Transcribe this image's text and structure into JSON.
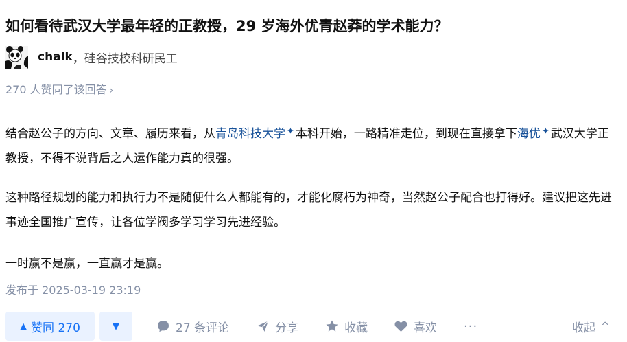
{
  "question": {
    "title": "如何看待武汉大学最年轻的正教授，29 岁海外优青赵莽的学术能力？"
  },
  "author": {
    "name": "chalk",
    "separator": "，",
    "bio": "硅谷技校科研民工"
  },
  "answer": {
    "votes_summary": "270 人赞同了该回答",
    "votes_chevron": "›",
    "p1_before": "结合赵公子的方向、文章、履历来看，从",
    "p1_link1": "青岛科技大学",
    "p1_mid": "本科开始，一路精准走位，到现在直接拿下",
    "p1_link2": "海优",
    "p1_after": "武汉大学正教授，不得不说背后之人运作能力真的很强。",
    "p2": "这种路径规划的能力和执行力不是随便什么人都能有的，才能化腐朽为神奇，当然赵公子配合也打得好。建议把这先进事迹全国推广宣传，让各位学阀多学习学习先进经验。",
    "p3": "一时赢不是赢，一直赢才是赢。",
    "sparkle": "✦",
    "published": "发布于 2025-03-19 23:19"
  },
  "actions": {
    "vote_up_icon": "▲",
    "vote_up_label": "赞同 270",
    "vote_down_icon": "▼",
    "comment_label": "27 条评论",
    "share_label": "分享",
    "favorite_label": "收藏",
    "like_label": "喜欢",
    "more_label": "···",
    "collapse_label": "收起",
    "collapse_icon": "^"
  },
  "icons": {
    "comment": "comment-icon",
    "share": "share-icon",
    "favorite": "star-icon",
    "like": "heart-icon",
    "avatar": "panda-avatar"
  },
  "colors": {
    "link": "#175199",
    "accent": "#1772f6",
    "accent_bg": "#eaf2ff",
    "meta": "#8590a6"
  }
}
